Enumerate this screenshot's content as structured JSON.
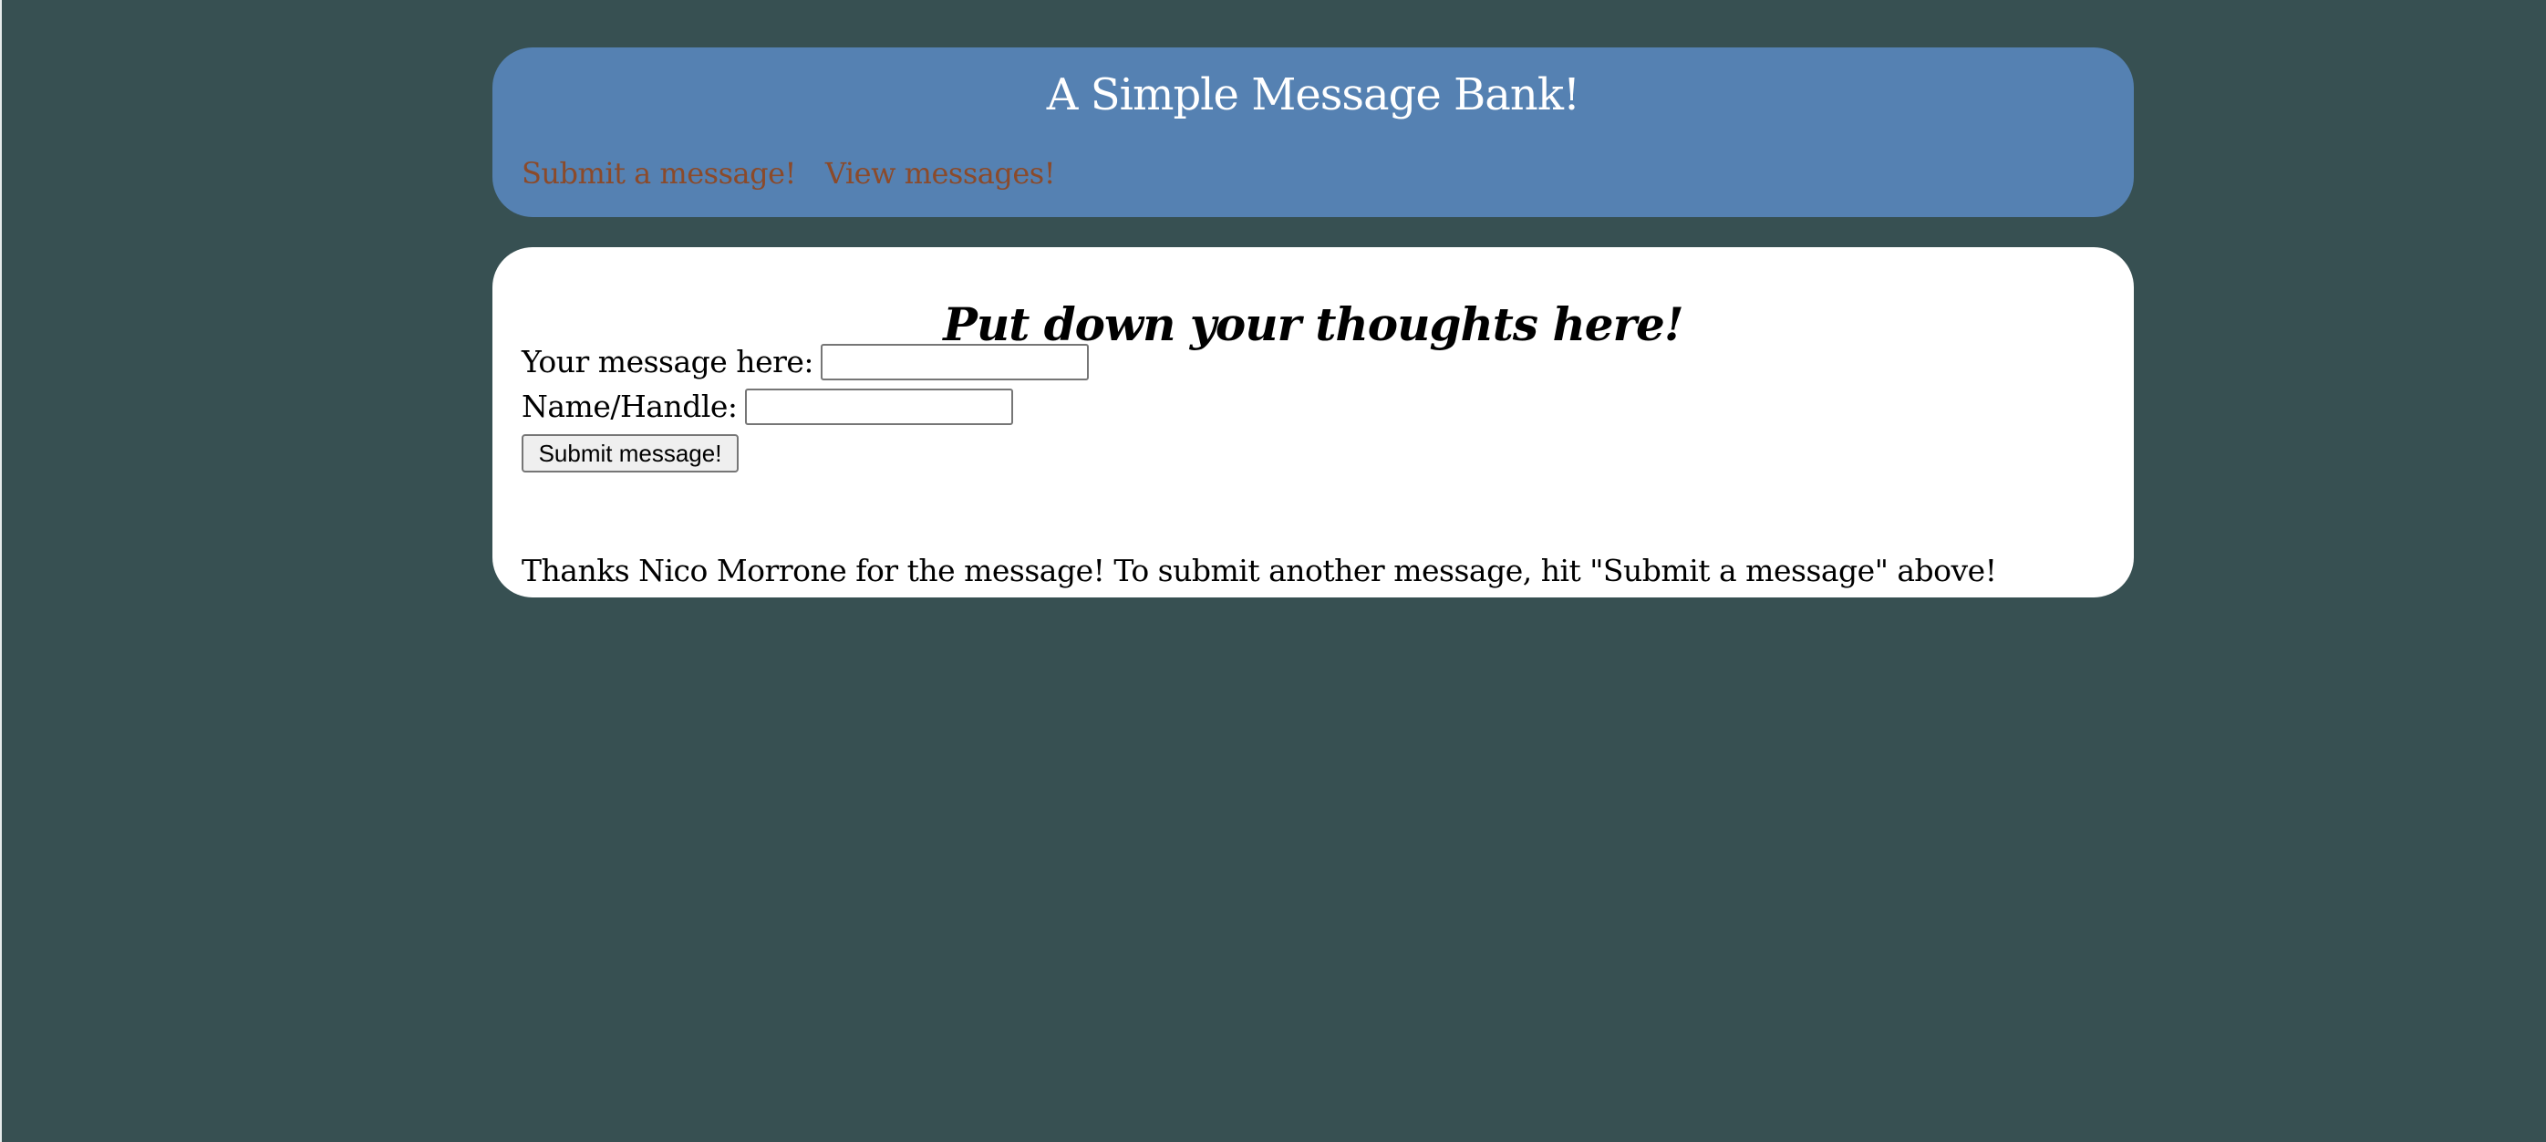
{
  "header": {
    "title": "A Simple Message Bank!",
    "nav": [
      {
        "label": "Submit a message!"
      },
      {
        "label": "View messages!"
      }
    ]
  },
  "main": {
    "heading": "Put down your thoughts here!",
    "form": {
      "message_label": "Your message here:",
      "message_value": "",
      "name_label": "Name/Handle:",
      "name_value": "",
      "submit_label": "Submit message!"
    },
    "confirmation": "Thanks Nico Morrone for the message! To submit another message, hit \"Submit a message\" above!"
  },
  "colors": {
    "page_background": "#375052",
    "header_background": "#5581b2",
    "header_text": "#ffffff",
    "link_text": "#8b4a2a",
    "content_background": "#ffffff"
  }
}
